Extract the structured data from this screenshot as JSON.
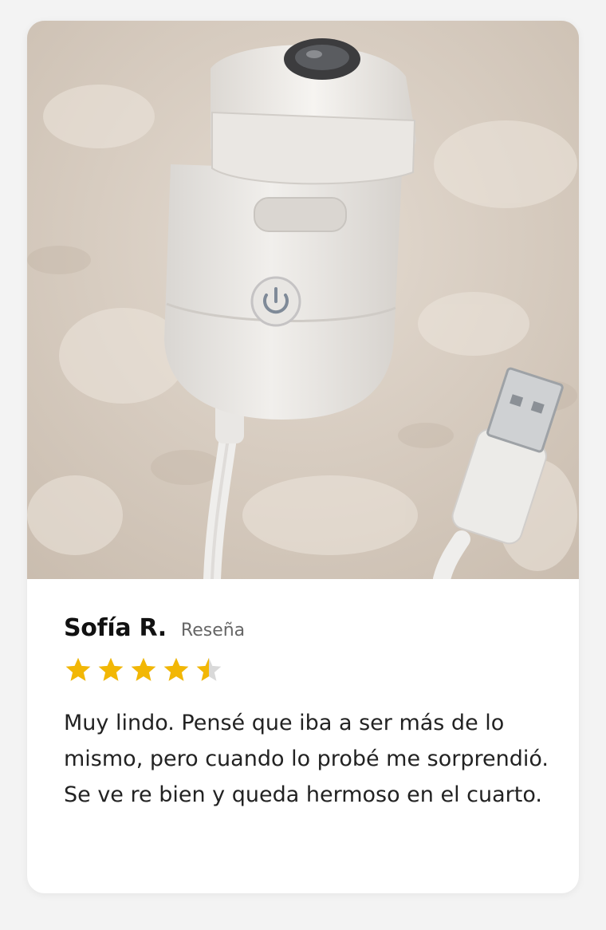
{
  "review": {
    "photo": {
      "icon": "product-photo-usb-device"
    },
    "reviewer_name": "Sofía R.",
    "tag": "Reseña",
    "rating": 4.5,
    "rating_max": 5,
    "star_color": "#f2b705",
    "star_empty_color": "#d9d9d9",
    "text": "Muy lindo. Pensé que iba a ser más de lo mismo, pero cuando lo probé me sorprendió. Se ve re bien y queda hermoso en el cuarto."
  }
}
